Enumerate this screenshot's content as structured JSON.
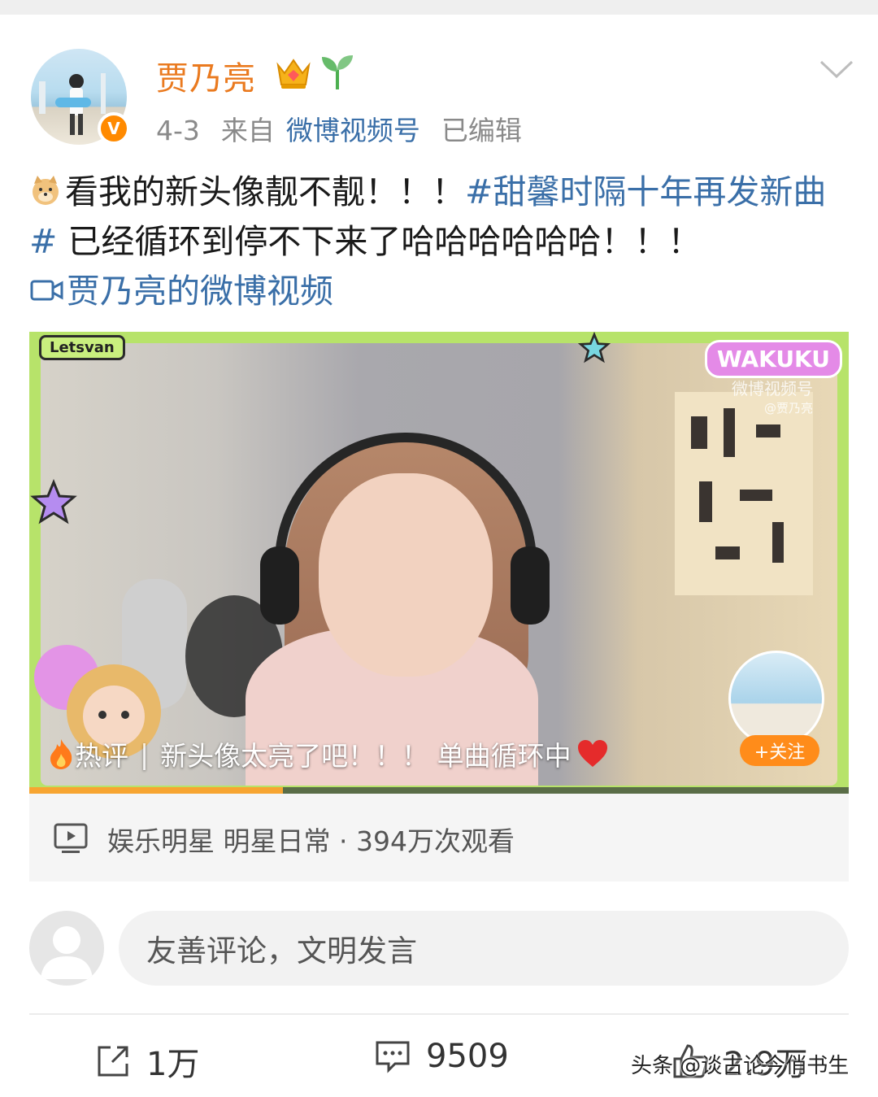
{
  "post": {
    "author": "贾乃亮",
    "date": "4-3",
    "source_prefix": "来自",
    "source": "微博视频号",
    "edited": "已编辑",
    "text_part1": "看我的新头像靓不靓！！！",
    "hashtag": "#甜馨时隔十年再发新曲#",
    "text_part2": " 已经循环到停不下来了哈哈哈哈哈哈！！！",
    "video_link": "贾乃亮的微博视频"
  },
  "video": {
    "logo": "Letsvan",
    "brand": "WAKUKU",
    "watermark": "微博视频号",
    "watermark_user": "@贾乃亮",
    "hot_label": "热评",
    "hot_comment": "新头像太亮了吧！！！ 单曲循环中",
    "follow_label": "+关注",
    "progress": 0.31
  },
  "video_info": {
    "text": "娱乐明星 明星日常 · 394万次观看"
  },
  "comment": {
    "placeholder": "友善评论，文明发言"
  },
  "actions": {
    "repost": "1万",
    "comments": "9509",
    "likes": "2.9万"
  },
  "footer": {
    "watermark": "头条 @谈古论今俏书生"
  },
  "icons": {
    "verified": "verified-badge-icon",
    "crown": "crown-icon",
    "sprout": "sprout-icon",
    "expand": "chevron-down-icon",
    "emoji": "doge-emoji-icon",
    "video_link": "video-camera-icon",
    "heart": "heart-icon",
    "fire": "fire-icon",
    "play": "video-play-icon",
    "repost": "repost-icon",
    "comment": "comment-icon",
    "like": "like-icon"
  },
  "colors": {
    "username": "#ea7a1f",
    "link": "#3a6fa8",
    "follow": "#ff8c1a",
    "frame": "#b7e36a"
  }
}
